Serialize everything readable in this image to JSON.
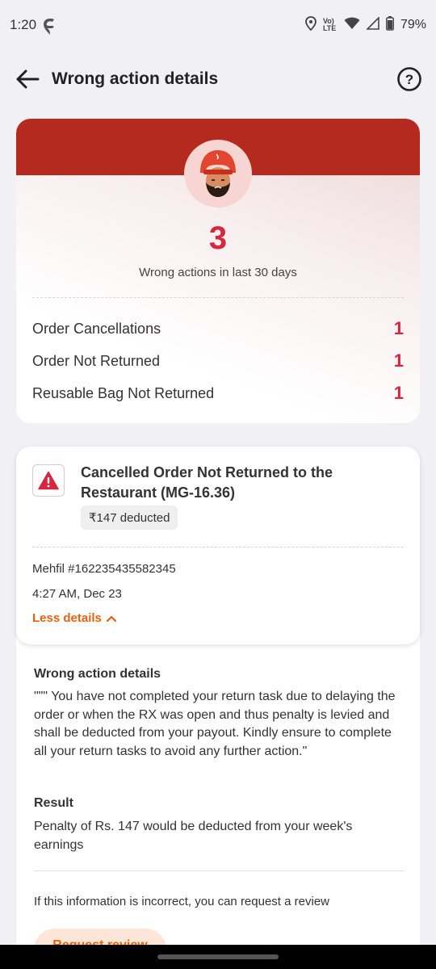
{
  "status_bar": {
    "time": "1:20",
    "battery": "79%",
    "icons": [
      "swiggy-logo-icon",
      "location-icon",
      "volte-icon",
      "wifi-icon",
      "signal-icon",
      "battery-icon"
    ],
    "volte_label": "Vo) LTE"
  },
  "header": {
    "title": "Wrong action details",
    "back_icon": "back-arrow-icon",
    "help_icon": "help-circle-icon"
  },
  "summary": {
    "count": "3",
    "count_label": "Wrong actions in last 30 days",
    "rows": [
      {
        "label": "Order Cancellations",
        "value": "1"
      },
      {
        "label": "Order Not Returned",
        "value": "1"
      },
      {
        "label": "Reusable Bag Not Returned",
        "value": "1"
      }
    ],
    "colors": {
      "band": "#b52a1e",
      "accent": "#d7263d"
    }
  },
  "order": {
    "title": "Cancelled Order Not Returned to the Restaurant (MG-16.36)",
    "deducted": "₹147 deducted",
    "order_id": "Mehfil #162235435582345",
    "time": "4:27 AM, Dec 23",
    "less_details": "Less details"
  },
  "details": {
    "heading": "Wrong action details",
    "text": "\"\"\" You have not completed your return task due to delaying the order or when the RX was open and thus penalty is levied and shall be deducted from your payout. Kindly ensure to complete all your return tasks to avoid any further action.\"",
    "result_heading": "Result",
    "result_text": "Penalty of Rs. 147 would be deducted from your week's earnings",
    "note": "If this information is incorrect, you can request a review",
    "review_button": "Request review",
    "accent": "#e8620e"
  }
}
